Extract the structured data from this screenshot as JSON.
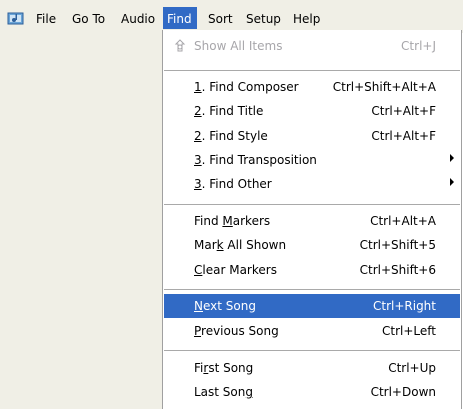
{
  "menubar": {
    "app_icon": "app-icon",
    "items": [
      {
        "label": "File"
      },
      {
        "label": "Go To"
      },
      {
        "label": "Audio"
      },
      {
        "label": "Find"
      },
      {
        "label": "Sort"
      },
      {
        "label": "Setup"
      },
      {
        "label": "Help"
      }
    ],
    "active_index": 3,
    "active_color": "#316ac5"
  },
  "find_menu": {
    "items": [
      {
        "label": "Show All Items",
        "shortcut": "Ctrl+J",
        "enabled": false,
        "icon": "show-all-icon"
      },
      {
        "pre": "",
        "u": "1",
        "post": ". Find Composer",
        "shortcut": "Ctrl+Shift+Alt+A"
      },
      {
        "pre": "",
        "u": "2",
        "post": ". Find Title",
        "shortcut": "Ctrl+Alt+F"
      },
      {
        "pre": "",
        "u": "2",
        "post": ". Find Style",
        "shortcut": "Ctrl+Alt+F"
      },
      {
        "pre": "",
        "u": "3",
        "post": ". Find Transposition",
        "submenu": true
      },
      {
        "pre": "",
        "u": "3",
        "post": ". Find Other",
        "submenu": true
      },
      {
        "pre": "Find ",
        "u": "M",
        "post": "arkers",
        "shortcut": "Ctrl+Alt+A"
      },
      {
        "pre": "Mar",
        "u": "k",
        "post": " All Shown",
        "shortcut": "Ctrl+Shift+5"
      },
      {
        "pre": "",
        "u": "C",
        "post": "lear Markers",
        "shortcut": "Ctrl+Shift+6"
      },
      {
        "pre": "",
        "u": "N",
        "post": "ext Song",
        "shortcut": "Ctrl+Right",
        "selected": true
      },
      {
        "pre": "",
        "u": "P",
        "post": "revious Song",
        "shortcut": "Ctrl+Left"
      },
      {
        "pre": "Fi",
        "u": "r",
        "post": "st Song",
        "shortcut": "Ctrl+Up"
      },
      {
        "pre": "Last Son",
        "u": "g",
        "post": "",
        "shortcut": "Ctrl+Down"
      }
    ],
    "selected_color": "#316ac5",
    "disabled_color": "#a7a6aa"
  }
}
